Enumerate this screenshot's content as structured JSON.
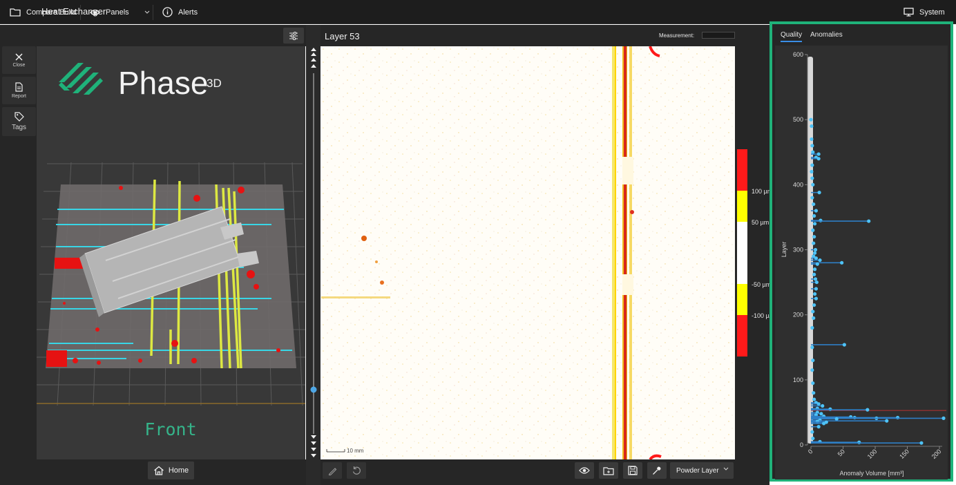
{
  "topbar": {
    "compare_label": "Compare Build",
    "panels_label": "Panels",
    "alerts_label": "Alerts",
    "system_label": "System"
  },
  "left": {
    "title": "Heat Exchanger",
    "tools": [
      {
        "label": "Close",
        "icon": "close-icon"
      },
      {
        "label": "Report",
        "icon": "report-icon"
      },
      {
        "label": "Tags",
        "icon": "tag-icon"
      }
    ],
    "brand": {
      "name": "Phase",
      "sup": "3D"
    },
    "view_label": "Front",
    "home_label": "Home"
  },
  "center": {
    "layer_title": "Layer 53",
    "measurement_label": "Measurement:",
    "scale_label": "10 mm",
    "legend_labels": [
      "100 µm",
      "50 µm",
      "-50 µm",
      "-100 µm"
    ],
    "legend_colors": [
      "#ff1a1a",
      "#ffff00",
      "#ffffff",
      "#ffff00",
      "#ff1a1a"
    ],
    "dropdown_value": "Powder Layer",
    "footer_icons": [
      "pencil-icon",
      "undo-icon",
      "eye-icon",
      "folder-icon",
      "save-icon",
      "eyedropper-icon"
    ]
  },
  "right": {
    "tabs": [
      "Quality",
      "Anomalies"
    ],
    "active_tab": "Quality",
    "accent": "#1fb27a"
  },
  "chart_data": {
    "type": "scatter",
    "title": "",
    "xlabel": "Anomaly Volume [mm³]",
    "ylabel": "Layer",
    "xlim": [
      0,
      200
    ],
    "ylim": [
      0,
      600
    ],
    "xticks": [
      0,
      50,
      100,
      150,
      200
    ],
    "yticks": [
      0,
      100,
      200,
      300,
      400,
      500,
      600
    ],
    "series": [
      {
        "color": "#4ec3f7",
        "points": [
          [
            0,
            500
          ],
          [
            1,
            490
          ],
          [
            1,
            470
          ],
          [
            2,
            460
          ],
          [
            3,
            450
          ],
          [
            12,
            447
          ],
          [
            8,
            442
          ],
          [
            12,
            440
          ],
          [
            2,
            430
          ],
          [
            1,
            420
          ],
          [
            2,
            410
          ],
          [
            3,
            400
          ],
          [
            13,
            388
          ],
          [
            2,
            380
          ],
          [
            4,
            370
          ],
          [
            8,
            360
          ],
          [
            5,
            352
          ],
          [
            15,
            345
          ],
          [
            90,
            344
          ],
          [
            6,
            340
          ],
          [
            3,
            330
          ],
          [
            5,
            320
          ],
          [
            4,
            310
          ],
          [
            7,
            300
          ],
          [
            6,
            295
          ],
          [
            4,
            290
          ],
          [
            8,
            287
          ],
          [
            14,
            284
          ],
          [
            48,
            280
          ],
          [
            10,
            278
          ],
          [
            6,
            270
          ],
          [
            5,
            262
          ],
          [
            7,
            255
          ],
          [
            9,
            250
          ],
          [
            8,
            240
          ],
          [
            6,
            232
          ],
          [
            8,
            225
          ],
          [
            5,
            215
          ],
          [
            3,
            205
          ],
          [
            4,
            195
          ],
          [
            2,
            180
          ],
          [
            52,
            154
          ],
          [
            2,
            150
          ],
          [
            3,
            130
          ],
          [
            2,
            115
          ],
          [
            3,
            95
          ],
          [
            4,
            80
          ],
          [
            5,
            70
          ],
          [
            8,
            65
          ],
          [
            12,
            63
          ],
          [
            18,
            60
          ],
          [
            10,
            56
          ],
          [
            30,
            55
          ],
          [
            88,
            54
          ],
          [
            10,
            50
          ],
          [
            16,
            48
          ],
          [
            8,
            46
          ],
          [
            20,
            44
          ],
          [
            62,
            43
          ],
          [
            68,
            42
          ],
          [
            135,
            42
          ],
          [
            102,
            41
          ],
          [
            208,
            41
          ],
          [
            40,
            40
          ],
          [
            14,
            38
          ],
          [
            118,
            37
          ],
          [
            10,
            36
          ],
          [
            24,
            35
          ],
          [
            20,
            33
          ],
          [
            12,
            28
          ],
          [
            2,
            20
          ],
          [
            3,
            10
          ],
          [
            14,
            5
          ],
          [
            75,
            4
          ],
          [
            172,
            3
          ]
        ]
      }
    ]
  }
}
